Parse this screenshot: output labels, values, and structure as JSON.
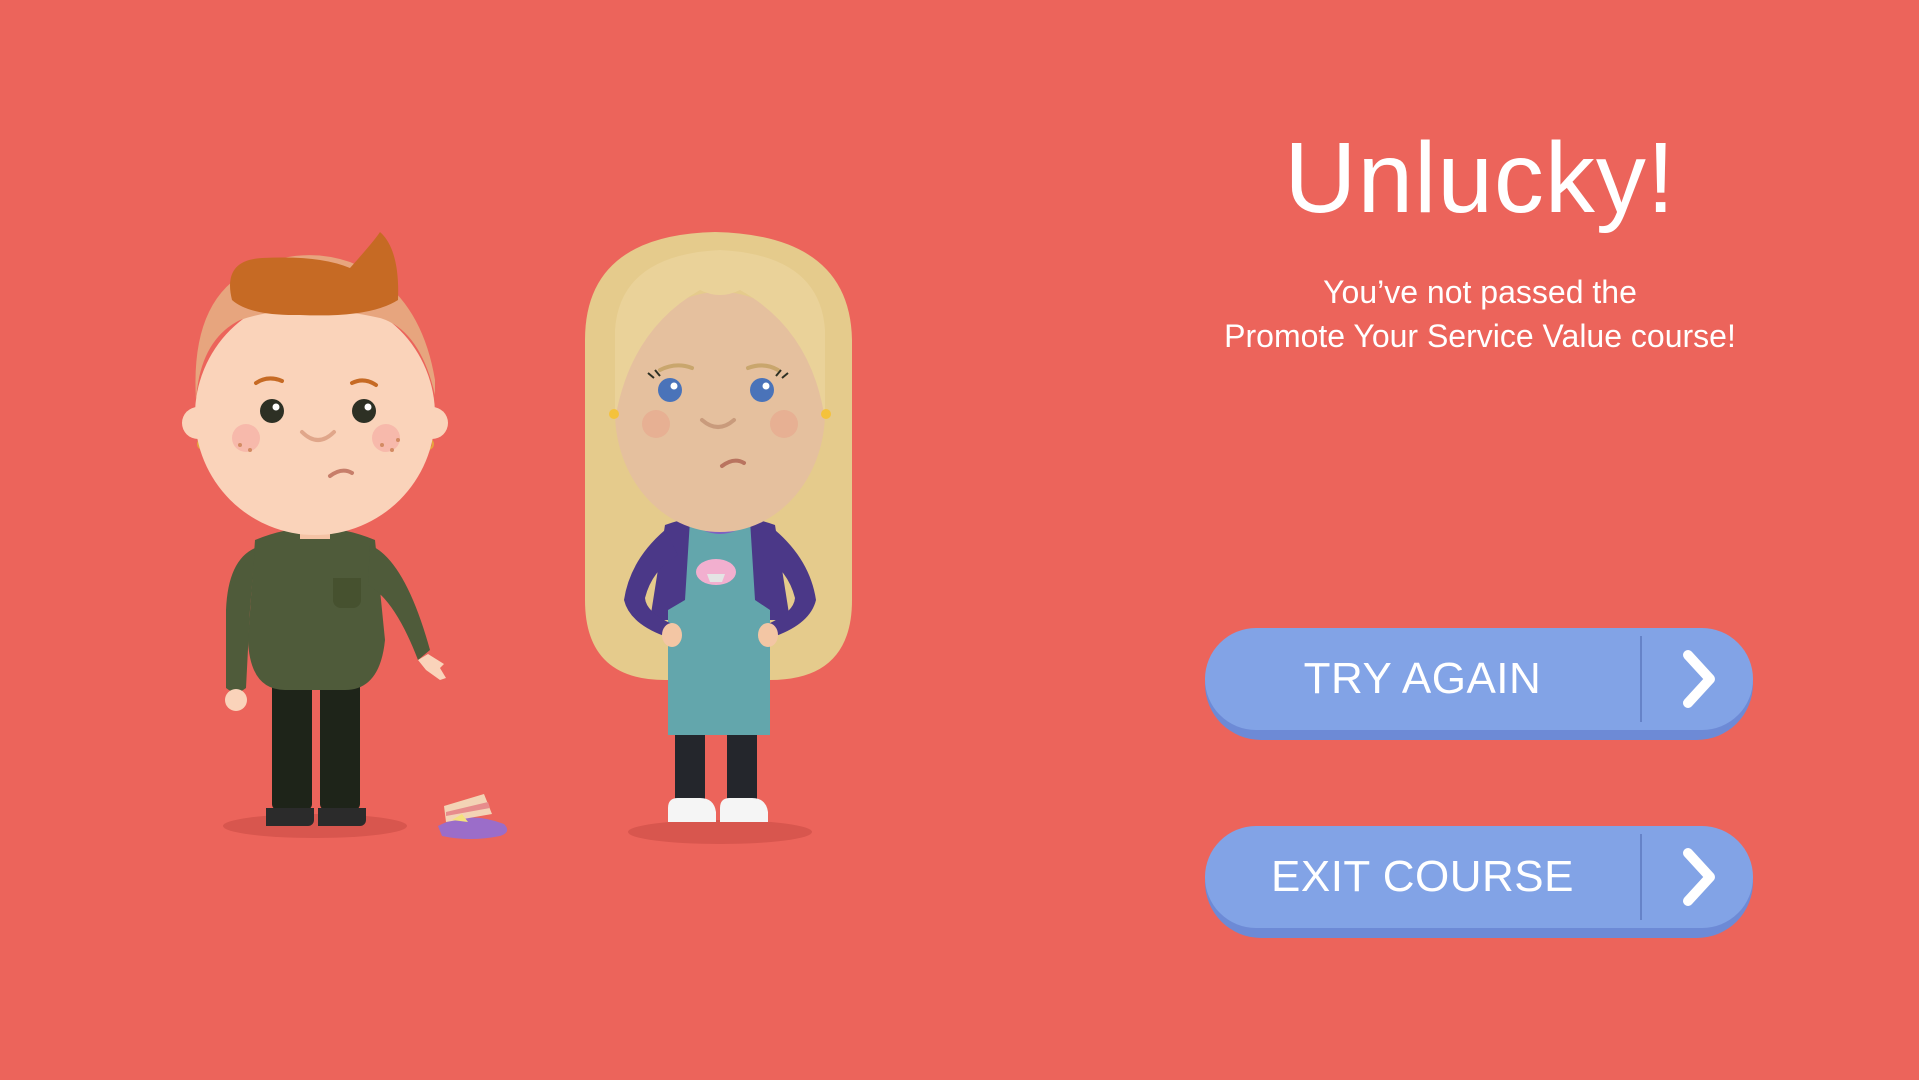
{
  "result": {
    "headline": "Unlucky!",
    "message_line1": "You’ve not passed the",
    "message_line2": "Promote Your Service Value course!"
  },
  "actions": {
    "try_again_label": "TRY AGAIN",
    "exit_course_label": "EXIT COURSE",
    "arrow_icon": "chevron-right-icon"
  },
  "colors": {
    "background": "#EC645B",
    "button": "#82A3E6",
    "button_shadow": "#6D8AD6",
    "text": "#FFFFFF"
  }
}
